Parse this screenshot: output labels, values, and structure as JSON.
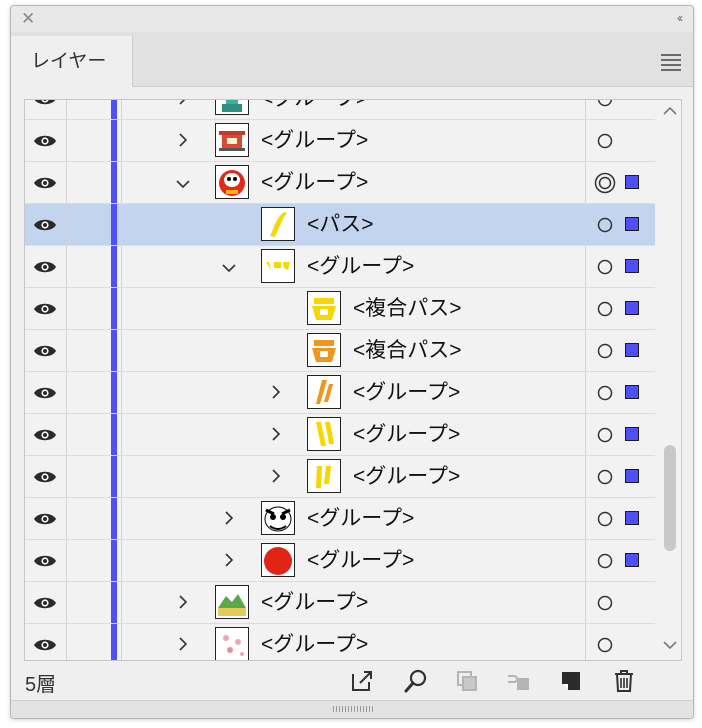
{
  "panel": {
    "tab_label": "レイヤー",
    "layer_count": "5層"
  },
  "icons": {
    "close": "close-icon",
    "collapse": "collapse-double-chevron-icon",
    "menu": "panel-menu-icon",
    "visibility": "eye-icon",
    "expand": "chevron-right-icon",
    "collapse_row": "chevron-down-icon",
    "target": "target-circle-icon",
    "export": "export-icon",
    "search": "locate-object-icon",
    "clipping": "clipping-mask-icon",
    "sublayer": "new-sublayer-icon",
    "new_layer": "new-layer-icon",
    "delete": "trash-icon"
  },
  "colors": {
    "layer_color": "#4f4ff7",
    "selected_row": "#c3d4ee"
  },
  "rows": [
    {
      "label": "<グループ>",
      "depth": 0,
      "arrow": "right",
      "thumb": "statue",
      "target": "ring",
      "sel": false,
      "selected": false
    },
    {
      "label": "<グループ>",
      "depth": 0,
      "arrow": "right",
      "thumb": "gate",
      "target": "ring",
      "sel": false,
      "selected": false
    },
    {
      "label": "<グループ>",
      "depth": 0,
      "arrow": "down",
      "thumb": "daruma",
      "target": "double",
      "sel": true,
      "selected": false
    },
    {
      "label": "<パス>",
      "depth": 1,
      "arrow": "none",
      "thumb": "stroke1",
      "target": "ring",
      "sel": true,
      "selected": true
    },
    {
      "label": "<グループ>",
      "depth": 1,
      "arrow": "down",
      "thumb": "yellowgroup",
      "target": "ring",
      "sel": true,
      "selected": false
    },
    {
      "label": "<複合パス>",
      "depth": 2,
      "arrow": "none",
      "thumb": "kanji_yellow",
      "target": "ring",
      "sel": true,
      "selected": false
    },
    {
      "label": "<複合パス>",
      "depth": 2,
      "arrow": "none",
      "thumb": "kanji_orange",
      "target": "ring",
      "sel": true,
      "selected": false
    },
    {
      "label": "<グループ>",
      "depth": 2,
      "arrow": "right",
      "thumb": "strokes_orange",
      "target": "ring",
      "sel": true,
      "selected": false
    },
    {
      "label": "<グループ>",
      "depth": 2,
      "arrow": "right",
      "thumb": "strokes_yellow2",
      "target": "ring",
      "sel": true,
      "selected": false
    },
    {
      "label": "<グループ>",
      "depth": 2,
      "arrow": "right",
      "thumb": "strokes_yellow1",
      "target": "ring",
      "sel": true,
      "selected": false
    },
    {
      "label": "<グループ>",
      "depth": 1,
      "arrow": "right",
      "thumb": "face",
      "target": "ring",
      "sel": true,
      "selected": false
    },
    {
      "label": "<グループ>",
      "depth": 1,
      "arrow": "right",
      "thumb": "redcircle",
      "target": "ring",
      "sel": true,
      "selected": false
    },
    {
      "label": "<グループ>",
      "depth": 0,
      "arrow": "right",
      "thumb": "mountain",
      "target": "ring",
      "sel": false,
      "selected": false
    },
    {
      "label": "<グループ>",
      "depth": 0,
      "arrow": "right",
      "thumb": "blossom",
      "target": "ring",
      "sel": false,
      "selected": false
    }
  ]
}
